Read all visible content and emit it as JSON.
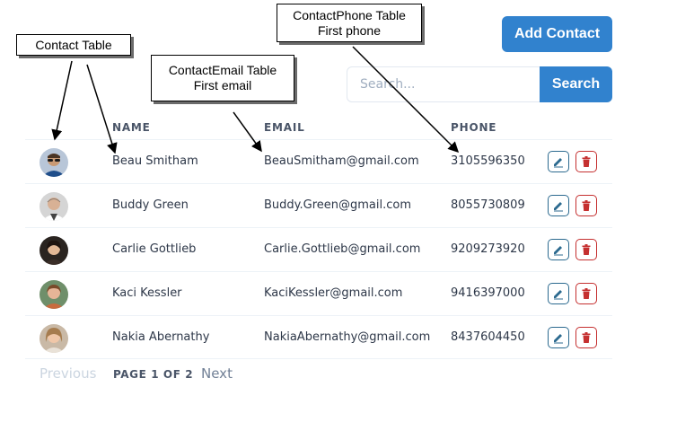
{
  "annotations": {
    "contact_table": "Contact Table",
    "contact_email": [
      "ContactEmail Table",
      "First email"
    ],
    "contact_phone": [
      "ContactPhone Table",
      "First phone"
    ]
  },
  "toolbar": {
    "add_contact_label": "Add Contact",
    "search_placeholder": "Search...",
    "search_label": "Search"
  },
  "table": {
    "headers": {
      "name": "NAME",
      "email": "EMAIL",
      "phone": "PHONE"
    },
    "rows": [
      {
        "name": "Beau Smitham",
        "email": "BeauSmitham@gmail.com",
        "phone": "3105596350",
        "avatar": "avatar-photo-man-sunglasses"
      },
      {
        "name": "Buddy Green",
        "email": "Buddy.Green@gmail.com",
        "phone": "8055730809",
        "avatar": "avatar-photo-man-bald"
      },
      {
        "name": "Carlie Gottlieb",
        "email": "Carlie.Gottlieb@gmail.com",
        "phone": "9209273920",
        "avatar": "avatar-photo-woman-dark-hair"
      },
      {
        "name": "Kaci Kessler",
        "email": "KaciKessler@gmail.com",
        "phone": "9416397000",
        "avatar": "avatar-photo-woman-short-hair"
      },
      {
        "name": "Nakia Abernathy",
        "email": "NakiaAbernathy@gmail.com",
        "phone": "8437604450",
        "avatar": "avatar-photo-woman-blonde"
      }
    ],
    "row_actions": {
      "edit_icon": "pencil-icon",
      "delete_icon": "trash-icon"
    }
  },
  "pagination": {
    "previous_label": "Previous",
    "page_info": "PAGE 1 OF 2",
    "next_label": "Next"
  },
  "colors": {
    "primary": "#3182ce",
    "edit": "#2c6a8f",
    "delete": "#c53030",
    "header_text": "#4a5568",
    "disabled": "#cbd5e0"
  }
}
